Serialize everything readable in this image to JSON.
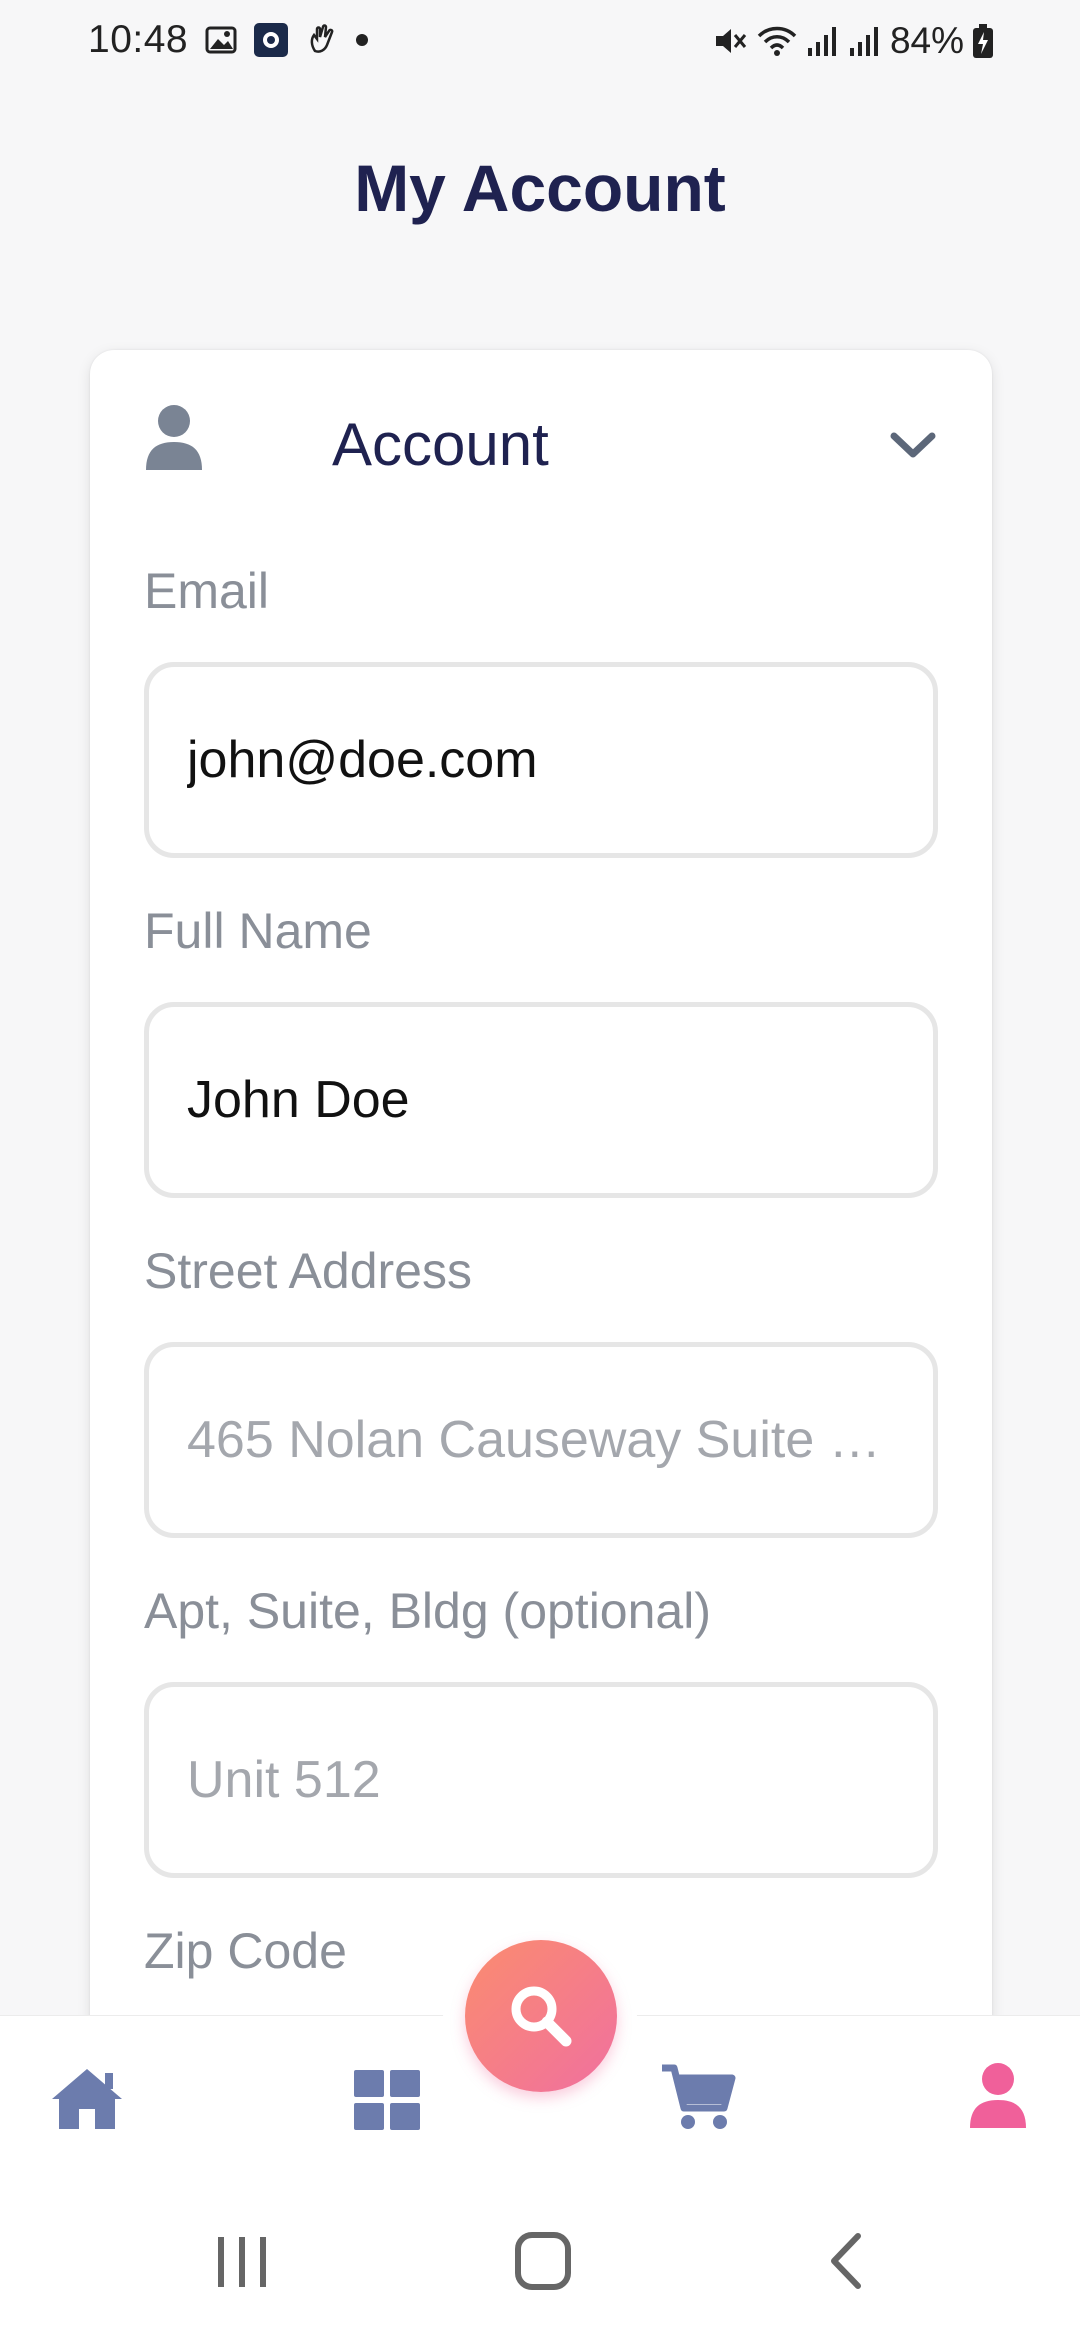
{
  "status_bar": {
    "time": "10:48",
    "battery": "84%"
  },
  "page": {
    "title": "My Account"
  },
  "account_section": {
    "title": "Account",
    "fields": [
      {
        "label": "Email",
        "value": "john@doe.com",
        "placeholder": ""
      },
      {
        "label": "Full Name",
        "value": "John Doe",
        "placeholder": ""
      },
      {
        "label": "Street Address",
        "value": "",
        "placeholder": "465 Nolan Causeway Suite …"
      },
      {
        "label": "Apt, Suite, Bldg (optional)",
        "value": "",
        "placeholder": "Unit 512"
      },
      {
        "label": "Zip Code",
        "value": "",
        "placeholder": ""
      }
    ]
  },
  "bottom_nav": {
    "items": [
      {
        "icon": "home-icon",
        "active": false
      },
      {
        "icon": "grid-icon",
        "active": false
      },
      {
        "icon": "search-icon",
        "active": false
      },
      {
        "icon": "cart-icon",
        "active": false
      },
      {
        "icon": "user-icon",
        "active": true
      }
    ]
  },
  "colors": {
    "title": "#1f2250",
    "label": "#8a8f98",
    "nav_inactive": "#6c7cad",
    "nav_active": "#f0609a",
    "fab_gradient_start": "#fb8c6f",
    "fab_gradient_end": "#f0709f"
  }
}
